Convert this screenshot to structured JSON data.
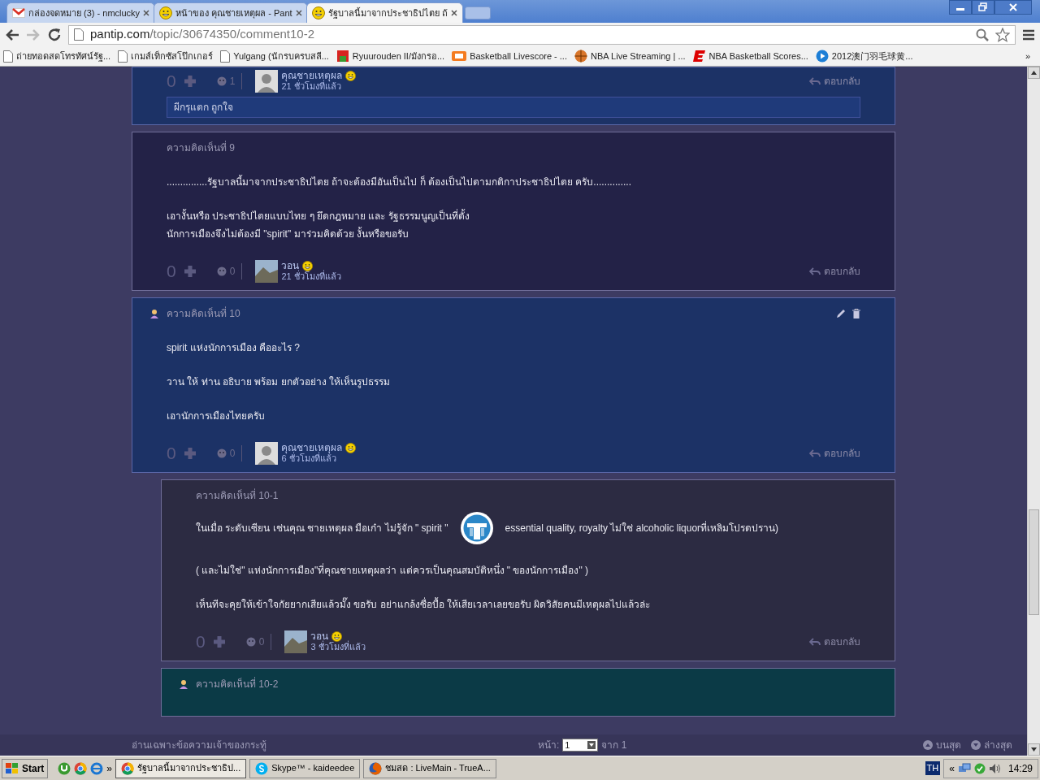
{
  "browser": {
    "tabs": [
      {
        "title": "กล่องจดหมาย (3) - nmclucky",
        "selected": false
      },
      {
        "title": "หน้าของ คุณชายเหตุผล - Pant",
        "selected": false
      },
      {
        "title": "รัฐบาลนี้มาจากประชาธิปไตย ถ้",
        "selected": true
      }
    ],
    "address": {
      "domain": "pantip.com",
      "path": "/topic/30674350/comment10-2"
    },
    "bookmarks": [
      {
        "label": "ถ่ายทอดสดโทรทัศน์รัฐ..."
      },
      {
        "label": "เกมส์เท็กซัสโป๊กเกอร์"
      },
      {
        "label": "Yulgang (นักรบครบสลี..."
      },
      {
        "label": "Ryuurouden II/มังกรอ..."
      },
      {
        "label": "Basketball Livescore - ..."
      },
      {
        "label": "NBA Live Streaming | ..."
      },
      {
        "label": "NBA Basketball Scores..."
      },
      {
        "label": "2012澳门羽毛球黄..."
      }
    ],
    "more": "»"
  },
  "comments": [
    {
      "kind": "own",
      "nested": false,
      "owner": false,
      "editable": false,
      "votes": "0",
      "emotions": "1",
      "author": "คุณชายเหตุผล",
      "time": "21 ชั่วโมงที่แล้ว",
      "reply": "ตอบกลับ",
      "quote": "ผีกรุแตก ถูกใจ"
    },
    {
      "kind": "other",
      "nested": false,
      "owner": false,
      "editable": false,
      "heading": "ความคิดเห็นที่ 9",
      "paragraphs": [
        {
          "lines": [
            "...............รัฐบาลนี้มาจากประชาธิปไตย ถ้าจะต้องมีอันเป็นไป ก็ ต้องเป็นไปตามกติกาประชาธิปไตย ครับ.............."
          ]
        },
        {
          "lines": [
            "เอางั้นหรือ ประชาธิปไตยแบบไทย ๆ ยึดกฎหมาย และ รัฐธรรมนูญเป็นที่ตั้ง",
            "นักการเมืองจึงไม่ต้องมี \"spirit\"  มาร่วมคิดด้วย  งั้นหรือขอรับ"
          ]
        }
      ],
      "votes": "0",
      "emotions": "0",
      "author": "วอน",
      "time": "21 ชั่วโมงที่แล้ว",
      "reply": "ตอบกลับ"
    },
    {
      "kind": "own",
      "nested": false,
      "owner": true,
      "editable": true,
      "heading": "ความคิดเห็นที่ 10",
      "paragraphs": [
        {
          "lines": [
            "spirit แห่งนักการเมือง คืออะไร ?"
          ]
        },
        {
          "lines": [
            "วาน ให้ ท่าน อธิบาย พร้อม ยกตัวอย่าง ให้เห็นรูปธรรม"
          ]
        },
        {
          "lines": [
            "เอานักการเมืองไทยครับ"
          ]
        }
      ],
      "votes": "0",
      "emotions": "0",
      "author": "คุณชายเหตุผล",
      "time": "6 ชั่วโมงที่แล้ว",
      "reply": "ตอบกลับ"
    },
    {
      "kind": "other",
      "nested": true,
      "owner": false,
      "editable": false,
      "heading": "ความคิดเห็นที่ 10-1",
      "paragraphs": [
        {
          "before": "ในเมื่อ ระดับเซียน เช่นคุณ ชายเหตุผล มือเก๋า ไม่รู้จัก \" spirit \"",
          "after": "essential quality, royalty ไม่ใช่ alcoholic liquorที่เหลิมโปรดปราน)"
        },
        {
          "lines": [
            "( และไม่ใช่\" แห่งนักการเมือง\"ที่คุณชายเหตุผลว่า   แต่ควรเป็นคุณสมบัติหนึ่ง \" ของนักการเมือง\" )"
          ]
        },
        {
          "lines": [
            "เห็นทีจะคุยให้เข้าใจกัยยากเสียแล้วมั๊ง ขอรับ อย่าแกล้งซื่อบื้อ ให้เสียเวลาเลยขอรับ ผิดวิสัยคนมีเหตุผลไปแล้วล่ะ"
          ]
        }
      ],
      "votes": "0",
      "emotions": "0",
      "author": "วอน",
      "time": "3 ชั่วโมงที่แล้ว",
      "reply": "ตอบกลับ"
    },
    {
      "kind": "target",
      "nested": true,
      "owner": true,
      "editable": false,
      "heading": "ความคิดเห็นที่ 10-2"
    }
  ],
  "bottom_bar": {
    "filter": "อ่านเฉพาะข้อความเจ้าของกระทู้",
    "page_label": "หน้า:",
    "page_value": "1",
    "page_total": "จาก 1",
    "to_top": "บนสุด",
    "to_bottom": "ล่างสุด"
  },
  "taskbar": {
    "start": "Start",
    "tasks": [
      {
        "label": "รัฐบาลนี้มาจากประชาธิป...",
        "selected": true
      },
      {
        "label": "Skype™ - kaideedee",
        "selected": false
      },
      {
        "label": "ชมสด : LiveMain - TrueA...",
        "selected": false
      }
    ],
    "quick_more": "»",
    "tray_more": "«",
    "language": "TH",
    "clock": "14:29"
  }
}
